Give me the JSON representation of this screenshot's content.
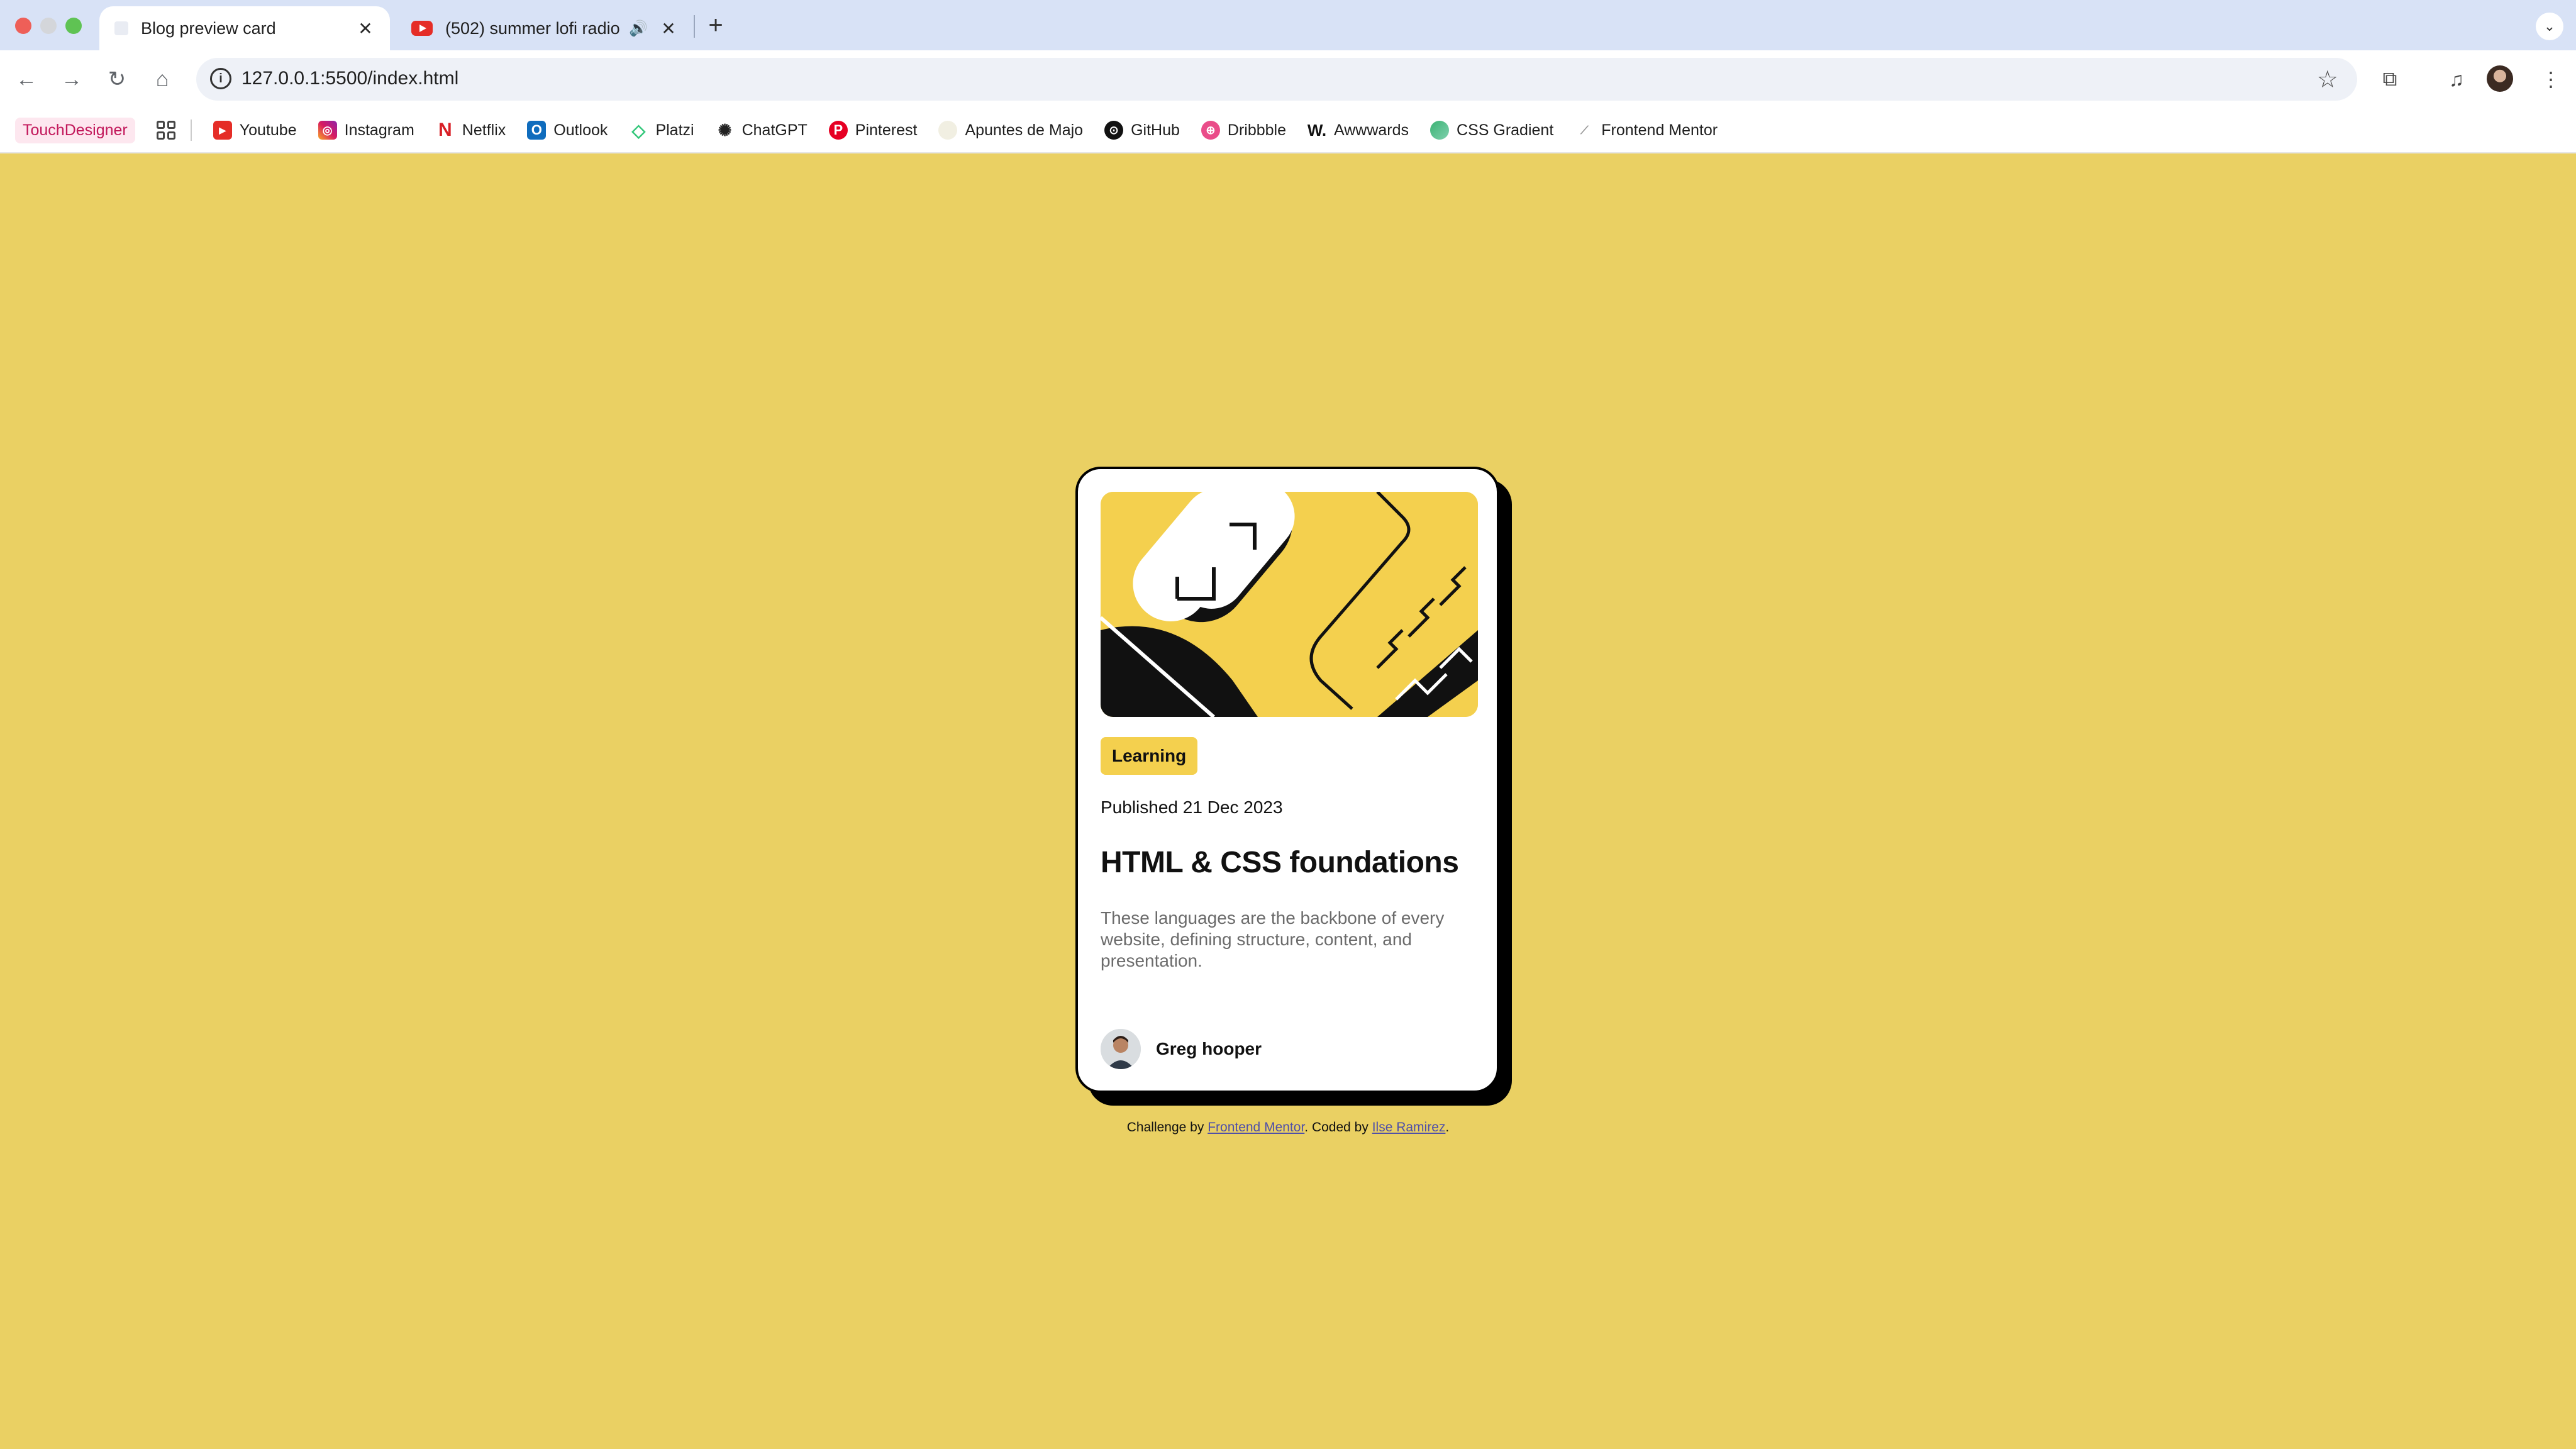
{
  "browser": {
    "tabs": [
      {
        "title": "Blog preview card",
        "active": true
      },
      {
        "title": "(502) summer lofi radio 🍵",
        "active": false
      }
    ],
    "url": "127.0.0.1:5500/index.html"
  },
  "bookmarks": [
    {
      "label": "TouchDesigner",
      "icon": "touchdesigner-icon"
    },
    {
      "label": "Youtube",
      "icon": "youtube-icon"
    },
    {
      "label": "Instagram",
      "icon": "instagram-icon"
    },
    {
      "label": "Netflix",
      "icon": "netflix-icon"
    },
    {
      "label": "Outlook",
      "icon": "outlook-icon"
    },
    {
      "label": "Platzi",
      "icon": "platzi-icon"
    },
    {
      "label": "ChatGPT",
      "icon": "chatgpt-icon"
    },
    {
      "label": "Pinterest",
      "icon": "pinterest-icon"
    },
    {
      "label": "Apuntes de Majo",
      "icon": "notion-icon"
    },
    {
      "label": "GitHub",
      "icon": "github-icon"
    },
    {
      "label": "Dribbble",
      "icon": "dribbble-icon"
    },
    {
      "label": "Awwwards",
      "icon": "awwwards-icon"
    },
    {
      "label": "CSS Gradient",
      "icon": "cssgradient-icon"
    },
    {
      "label": "Frontend Mentor",
      "icon": "frontendmentor-icon"
    }
  ],
  "card": {
    "tag": "Learning",
    "published": "Published 21 Dec 2023",
    "title": "HTML & CSS foundations",
    "description": "These languages are the backbone of every website, defining structure, content, and presentation.",
    "author": "Greg hooper"
  },
  "attribution": {
    "prefix": "Challenge by",
    "challenge_link": "Frontend Mentor",
    "middle": ". Coded by",
    "coder_link": "Ilse Ramirez",
    "suffix": "."
  },
  "colors": {
    "background": "#ead063",
    "accent": "#f4d04e",
    "text": "#111111",
    "muted": "#6b6b6b"
  }
}
